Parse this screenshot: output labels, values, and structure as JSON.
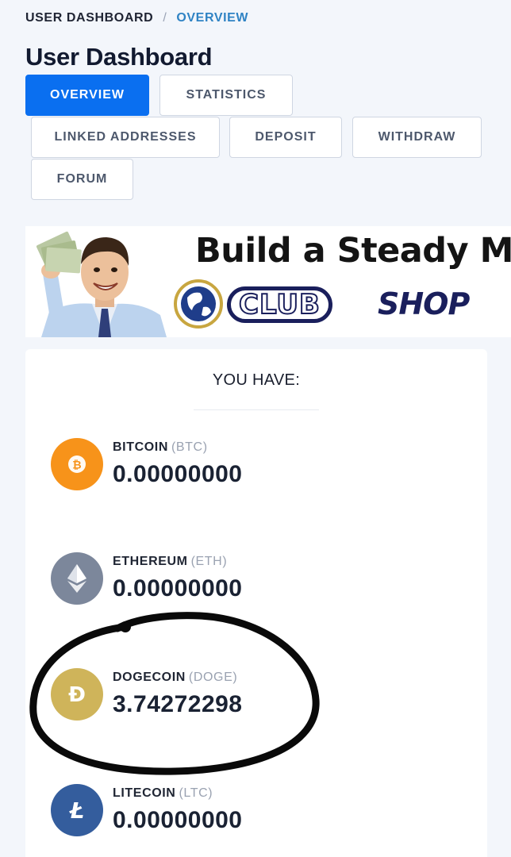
{
  "breadcrumb": {
    "home": "USER DASHBOARD",
    "separator": "/",
    "current": "OVERVIEW"
  },
  "page_title": "User Dashboard",
  "tabs": [
    {
      "label": "OVERVIEW",
      "active": true
    },
    {
      "label": "STATISTICS",
      "active": false
    },
    {
      "label": "LINKED ADDRESSES",
      "active": false
    },
    {
      "label": "DEPOSIT",
      "active": false
    },
    {
      "label": "WITHDRAW",
      "active": false
    },
    {
      "label": "FORUM",
      "active": false
    }
  ],
  "banner": {
    "headline": "Build a  Steady M",
    "logo_text": "CLUB",
    "logo_shop": "SHOP",
    "icons": [
      "person-holding-money-image",
      "globe-icon"
    ]
  },
  "balances": {
    "title": "YOU HAVE:",
    "coins": [
      {
        "name": "BITCOIN",
        "symbol": "(BTC)",
        "amount": "0.00000000",
        "icon": "bitcoin-icon",
        "color": "#f7931a"
      },
      {
        "name": "ETHEREUM",
        "symbol": "(ETH)",
        "amount": "0.00000000",
        "icon": "ethereum-icon",
        "color": "#7c879b"
      },
      {
        "name": "DOGECOIN",
        "symbol": "(DOGE)",
        "amount": "3.74272298",
        "icon": "dogecoin-icon",
        "color": "#cfb45a"
      },
      {
        "name": "LITECOIN",
        "symbol": "(LTC)",
        "amount": "0.00000000",
        "icon": "litecoin-icon",
        "color": "#345d9d"
      }
    ]
  },
  "colors": {
    "accent": "#0a6ff0",
    "breadcrumb_current": "#2f83c4",
    "page_bg": "#f3f6fb"
  }
}
